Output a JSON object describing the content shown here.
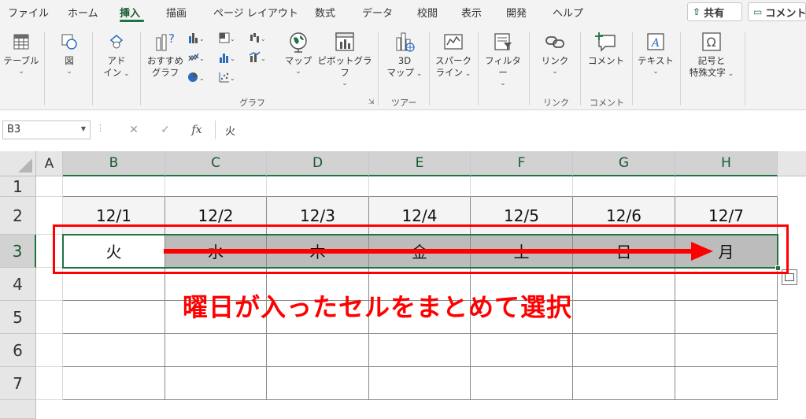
{
  "menu": {
    "tabs": [
      "ファイル",
      "ホーム",
      "挿入",
      "描画",
      "ページ レイアウト",
      "数式",
      "データ",
      "校閲",
      "表示",
      "開発",
      "ヘルプ"
    ],
    "active_tab": "挿入",
    "share_label": "共有",
    "comment_label": "コメント"
  },
  "ribbon": {
    "buttons": {
      "table": "テーブル",
      "figure": "図",
      "addins_1": "アド",
      "addins_2": "イン",
      "recommended_chart_1": "おすすめ",
      "recommended_chart_2": "グラフ",
      "map": "マップ",
      "pivot_chart": "ピボットグラフ",
      "map3d_1": "3D",
      "map3d_2": "マップ",
      "sparkline_1": "スパーク",
      "sparkline_2": "ライン",
      "filter": "フィルター",
      "link": "リンク",
      "comment": "コメント",
      "text": "テキスト",
      "symbols_1": "記号と",
      "symbols_2": "特殊文字"
    },
    "groups": {
      "chart": "グラフ",
      "tour": "ツアー",
      "link": "リンク",
      "comment": "コメント"
    }
  },
  "formula_bar": {
    "name_box": "B3",
    "fx_label": "fx",
    "content": "火"
  },
  "sheet": {
    "columns": [
      "A",
      "B",
      "C",
      "D",
      "E",
      "F",
      "G",
      "H"
    ],
    "rows": [
      "1",
      "2",
      "3",
      "4",
      "5",
      "6",
      "7"
    ],
    "dates": [
      "12/1",
      "12/2",
      "12/3",
      "12/4",
      "12/5",
      "12/6",
      "12/7"
    ],
    "weekdays": [
      "火",
      "水",
      "木",
      "金",
      "土",
      "日",
      "月"
    ]
  },
  "annotation": {
    "text": "曜日が入ったセルをまとめて選択",
    "color": "#ff0000"
  },
  "colors": {
    "accent": "#217346",
    "selection_fill": "#bcbcbc"
  }
}
